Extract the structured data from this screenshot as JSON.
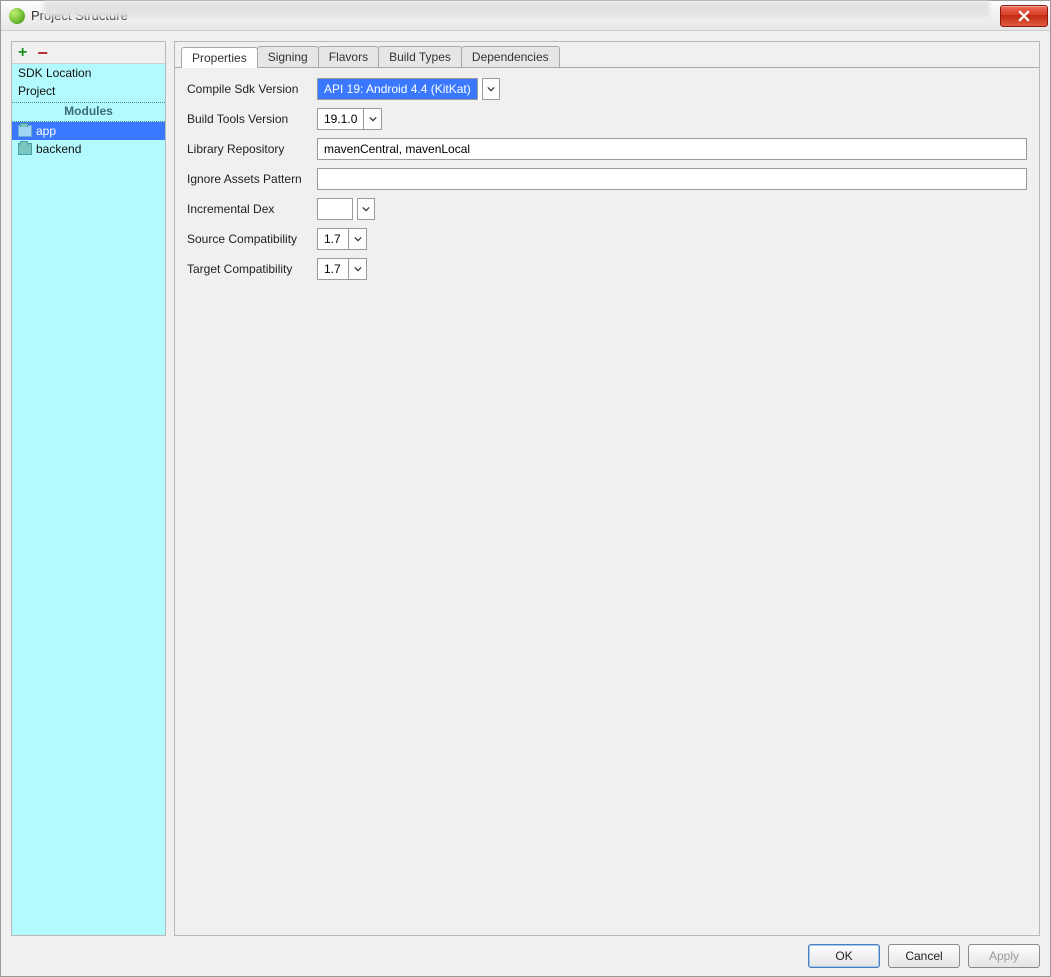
{
  "window": {
    "title": "Project Structure"
  },
  "sidebar": {
    "items_top": [
      {
        "label": "SDK Location"
      },
      {
        "label": "Project"
      }
    ],
    "modules_header": "Modules",
    "modules": [
      {
        "label": "app"
      },
      {
        "label": "backend"
      }
    ]
  },
  "tabs": [
    {
      "label": "Properties"
    },
    {
      "label": "Signing"
    },
    {
      "label": "Flavors"
    },
    {
      "label": "Build Types"
    },
    {
      "label": "Dependencies"
    }
  ],
  "form": {
    "compile_sdk_label": "Compile Sdk Version",
    "compile_sdk_value": "API 19: Android 4.4 (KitKat)",
    "build_tools_label": "Build Tools Version",
    "build_tools_value": "19.1.0",
    "library_repo_label": "Library Repository",
    "library_repo_value": "mavenCentral, mavenLocal",
    "ignore_assets_label": "Ignore Assets Pattern",
    "ignore_assets_value": "",
    "incremental_dex_label": "Incremental Dex",
    "incremental_dex_value": "",
    "source_compat_label": "Source Compatibility",
    "source_compat_value": "1.7",
    "target_compat_label": "Target Compatibility",
    "target_compat_value": "1.7"
  },
  "footer": {
    "ok": "OK",
    "cancel": "Cancel",
    "apply": "Apply"
  }
}
